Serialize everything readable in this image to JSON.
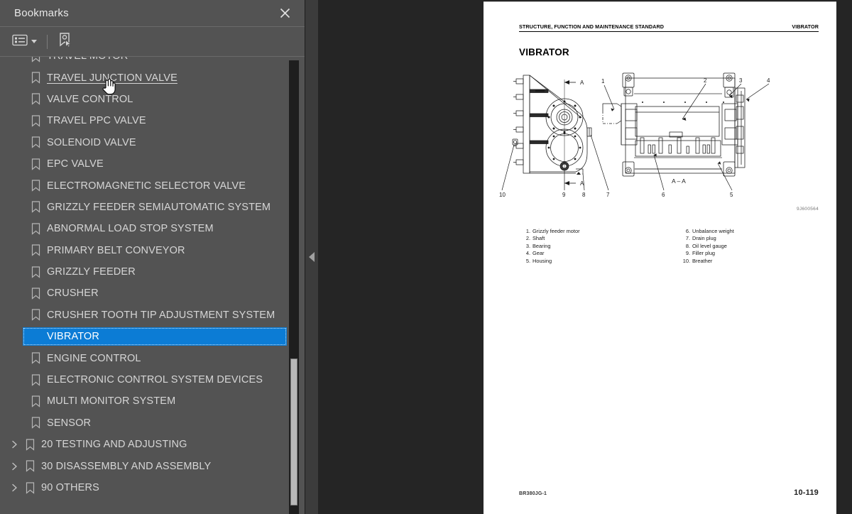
{
  "panel": {
    "title": "Bookmarks",
    "close_icon": "close-icon",
    "toolbar": {
      "options_label": "Bookmark options",
      "options_icon": "list-options-icon",
      "new_bookmark_label": "New bookmark",
      "new_bookmark_icon": "new-bookmark-icon"
    },
    "items": [
      {
        "label": "TRAVEL MOTOR",
        "state": "partial-top"
      },
      {
        "label": "TRAVEL JUNCTION VALVE",
        "state": "hovered"
      },
      {
        "label": "VALVE CONTROL",
        "state": "normal"
      },
      {
        "label": "TRAVEL PPC VALVE",
        "state": "normal"
      },
      {
        "label": "SOLENOID VALVE",
        "state": "normal"
      },
      {
        "label": "EPC VALVE",
        "state": "normal"
      },
      {
        "label": "ELECTROMAGNETIC SELECTOR VALVE",
        "state": "normal"
      },
      {
        "label": "GRIZZLY FEEDER SEMIAUTOMATIC SYSTEM",
        "state": "normal"
      },
      {
        "label": "ABNORMAL LOAD STOP SYSTEM",
        "state": "normal"
      },
      {
        "label": "PRIMARY BELT CONVEYOR",
        "state": "normal"
      },
      {
        "label": "GRIZZLY FEEDER",
        "state": "normal"
      },
      {
        "label": "CRUSHER",
        "state": "normal"
      },
      {
        "label": "CRUSHER TOOTH TIP ADJUSTMENT SYSTEM",
        "state": "normal"
      },
      {
        "label": "VIBRATOR",
        "state": "selected"
      },
      {
        "label": "ENGINE CONTROL",
        "state": "normal"
      },
      {
        "label": "ELECTRONIC CONTROL SYSTEM DEVICES",
        "state": "normal"
      },
      {
        "label": "MULTI MONITOR SYSTEM",
        "state": "normal"
      },
      {
        "label": "SENSOR",
        "state": "normal"
      },
      {
        "label": "20  TESTING AND ADJUSTING",
        "state": "collapsed"
      },
      {
        "label": "30 DISASSEMBLY AND ASSEMBLY",
        "state": "collapsed"
      },
      {
        "label": "90  OTHERS",
        "state": "collapsed"
      }
    ],
    "selected_label": "VIBRATOR",
    "hovered_label": "TRAVEL JUNCTION VALVE",
    "accent_color": "#0c7cd5",
    "panel_bg": "#535353"
  },
  "splitter": {
    "collapse_icon": "collapse-left-arrow-icon"
  },
  "document": {
    "header_left": "STRUCTURE, FUNCTION AND MAINTENANCE STANDARD",
    "header_right": "VIBRATOR",
    "title": "VIBRATOR",
    "figure": {
      "ref_number": "9J600564",
      "section_label": "A – A",
      "section_marks": [
        "A",
        "A"
      ],
      "callouts": [
        "1",
        "2",
        "3",
        "4",
        "5",
        "6",
        "7",
        "8",
        "9",
        "10"
      ]
    },
    "legend": {
      "column_1": [
        {
          "num": "1.",
          "text": "Grizzly feeder motor"
        },
        {
          "num": "2.",
          "text": "Shaft"
        },
        {
          "num": "3.",
          "text": "Bearing"
        },
        {
          "num": "4.",
          "text": "Gear"
        },
        {
          "num": "5.",
          "text": "Housing"
        }
      ],
      "column_2": [
        {
          "num": "6.",
          "text": "Unbalance weight"
        },
        {
          "num": "7.",
          "text": "Drain plug"
        },
        {
          "num": "8.",
          "text": "Oil level gauge"
        },
        {
          "num": "9.",
          "text": "Filler plug"
        },
        {
          "num": "10.",
          "text": "Breather"
        }
      ]
    },
    "footer_left": "BR380JG-1",
    "footer_right": "10-119"
  }
}
